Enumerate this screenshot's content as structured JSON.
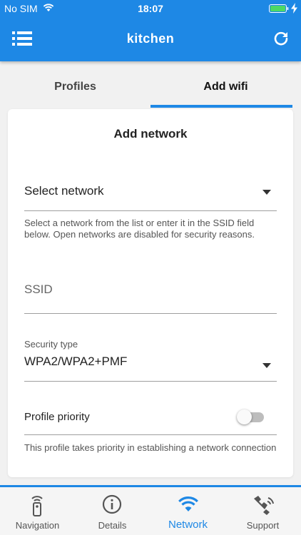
{
  "status_bar": {
    "carrier": "No SIM",
    "time": "18:07"
  },
  "app_bar": {
    "title": "kitchen"
  },
  "tabs": [
    {
      "label": "Profiles",
      "active": false
    },
    {
      "label": "Add wifi",
      "active": true
    }
  ],
  "form": {
    "title": "Add network",
    "network_select": {
      "value": "Select network",
      "helper": "Select a network from the list or enter it in the SSID field below. Open networks are disabled for security reasons."
    },
    "ssid": {
      "placeholder": "SSID",
      "value": ""
    },
    "security": {
      "label": "Security type",
      "value": "WPA2/WPA2+PMF"
    },
    "priority": {
      "label": "Profile priority",
      "enabled": false,
      "helper": "This profile takes priority in establishing a network connection"
    }
  },
  "bottom_nav": [
    {
      "label": "Navigation",
      "icon": "remote-icon",
      "active": false
    },
    {
      "label": "Details",
      "icon": "info-icon",
      "active": false
    },
    {
      "label": "Network",
      "icon": "wifi-icon",
      "active": true
    },
    {
      "label": "Support",
      "icon": "support-icon",
      "active": false
    }
  ],
  "colors": {
    "primary": "#1e88e5",
    "battery": "#4cd964",
    "background": "#f1f1f1"
  }
}
